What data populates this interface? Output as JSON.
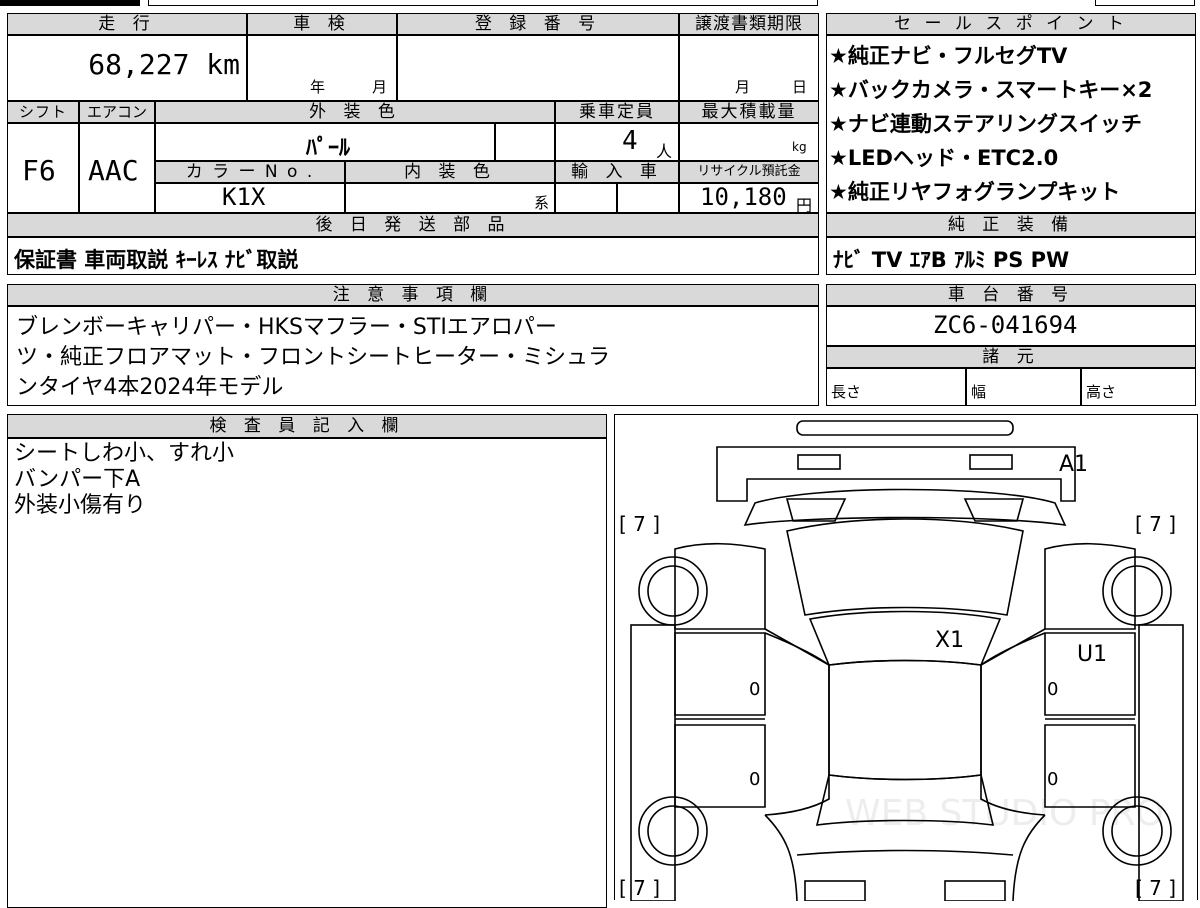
{
  "top_table": {
    "mileage_label": "走 行",
    "mileage_value": "68,227 km",
    "inspection_label": "車 検",
    "inspection_year": "年",
    "inspection_month": "月",
    "registration_label": "登 録 番 号",
    "transfer_label": "譲渡書類期限",
    "transfer_month": "月",
    "transfer_day": "日",
    "shift_label": "シフト",
    "shift_value": "F6",
    "aircon_label": "エアコン",
    "aircon_value": "AAC",
    "exterior_label": "外 装 色",
    "exterior_value": "ﾊﾟｰﾙ",
    "capacity_label": "乗車定員",
    "capacity_value": "4",
    "capacity_unit": "人",
    "maxload_label": "最大積載量",
    "maxload_unit": "kg",
    "colorno_label": "カ ラ ー  N o .",
    "colorno_value": "K1X",
    "interior_label": "内 装 色",
    "interior_unit": "系",
    "import_label": "輸 入 車",
    "recycle_label": "リサイクル預託金",
    "recycle_value": "10,180",
    "recycle_unit": "円",
    "later_parts_label": "後 日 発 送 部 品",
    "later_parts_value": "保証書 車両取説 ｷｰﾚｽ ﾅﾋﾞ取説"
  },
  "sales_points": {
    "label": "セ ー ル ス ポ イ ン ト",
    "items": [
      "★純正ナビ・フルセグTV",
      "★バックカメラ・スマートキー×2",
      "★ナビ連動ステアリングスイッチ",
      "★LEDヘッド・ETC2.0",
      "★純正リヤフォグランプキット"
    ]
  },
  "equipment": {
    "label": "純 正 装 備",
    "value": "ﾅﾋﾞ TV ｴｱB ｱﾙﾐ PS PW"
  },
  "notes": {
    "label": "注 意 事 項 欄",
    "lines": [
      "ブレンボーキャリパー・HKSマフラー・STIエアロパー",
      "ツ・純正フロアマット・フロントシートヒーター・ミシュラ",
      "ンタイヤ4本2024年モデル"
    ]
  },
  "chassis": {
    "label": "車 台 番 号",
    "value": "ZC6-041694"
  },
  "specs": {
    "label": "諸 元",
    "length": "長さ",
    "width": "幅",
    "height": "高さ"
  },
  "inspector": {
    "label": "検 査 員 記 入 欄",
    "lines": [
      "シートしわ小、すれ小",
      "バンパー下A",
      "外装小傷有り"
    ]
  },
  "diagram": {
    "mark_a1": "A1",
    "mark_x1": "X1",
    "mark_u1": "U1",
    "bracket": "[ 7 ]",
    "door_zero": "0",
    "watermark": "WEB STUDIO PRO"
  }
}
